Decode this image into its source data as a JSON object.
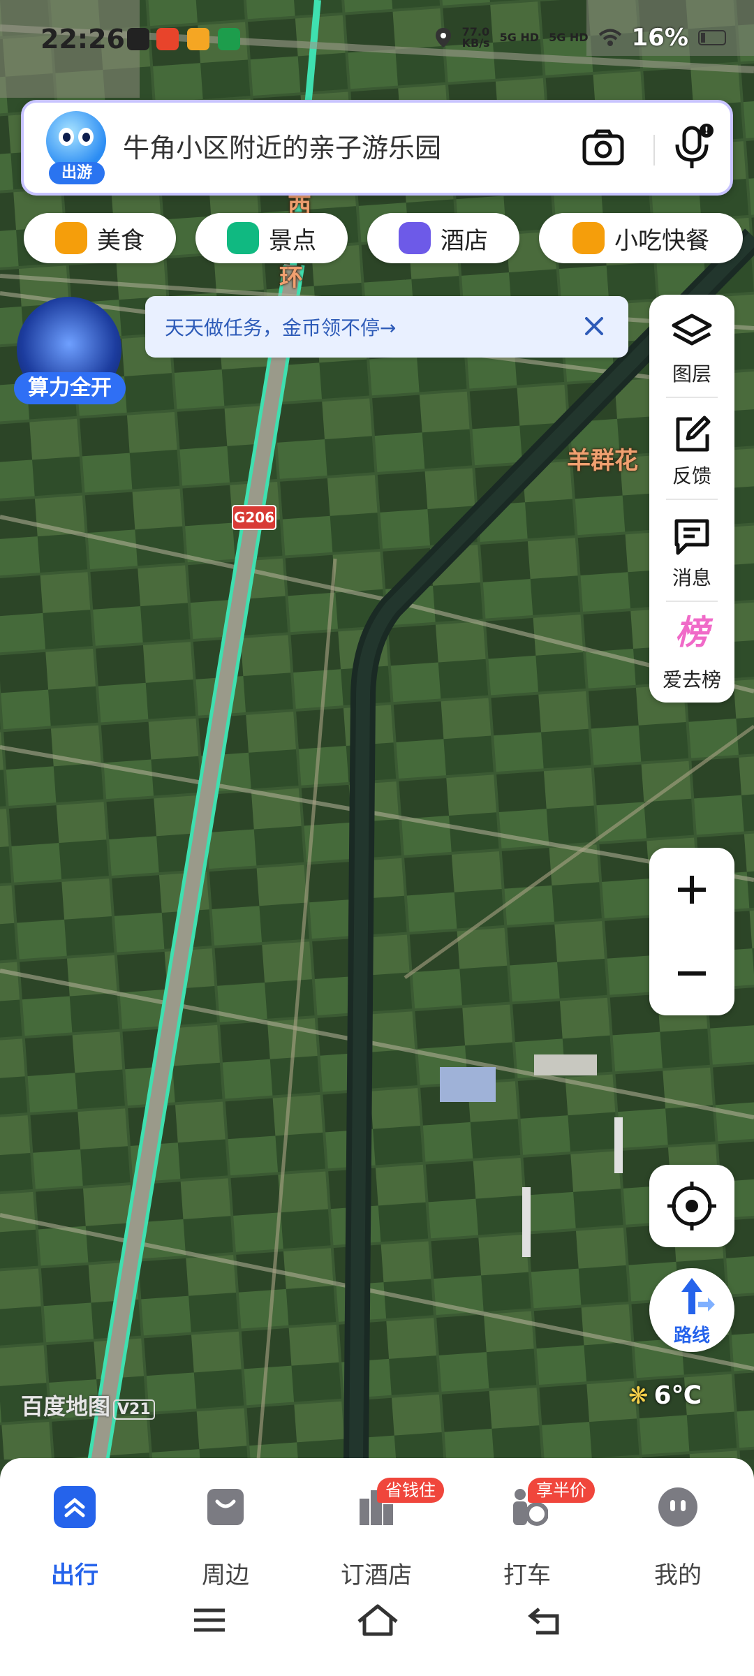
{
  "status_bar": {
    "time": "22:26",
    "net_speed_top": "77.0",
    "net_speed_unit": "KB/s",
    "sim1": "5G HD",
    "sim2": "5G HD",
    "battery": "16%"
  },
  "search": {
    "mascot_tag": "出游",
    "query": "牛角小区附近的亲子游乐园"
  },
  "chips": [
    {
      "label": "美食",
      "color": "#f59e0b"
    },
    {
      "label": "景点",
      "color": "#10b981"
    },
    {
      "label": "酒店",
      "color": "#6d5ae8"
    },
    {
      "label": "小吃快餐",
      "color": "#f59e0b"
    }
  ],
  "compute_widget": {
    "label": "算力全开"
  },
  "banner": {
    "text": "天天做任务，金币领不停→"
  },
  "toolbar": [
    {
      "label": "图层",
      "icon": "layers-icon"
    },
    {
      "label": "反馈",
      "icon": "feedback-icon"
    },
    {
      "label": "消息",
      "icon": "message-icon"
    },
    {
      "label": "爱去榜",
      "icon": "ranking-icon",
      "glyph": "榜"
    }
  ],
  "map": {
    "labels": {
      "top_road_a": "西",
      "top_road_b": "环",
      "place": "羊群花"
    },
    "road_shield": "G206",
    "brand": "百度地图",
    "brand_version": "V21",
    "temperature": "6℃"
  },
  "route_button": {
    "label": "路线"
  },
  "bottom_nav": [
    {
      "label": "出行",
      "active": true
    },
    {
      "label": "周边",
      "active": false
    },
    {
      "label": "订酒店",
      "active": false,
      "badge": "省钱住"
    },
    {
      "label": "打车",
      "active": false,
      "badge": "享半价"
    },
    {
      "label": "我的",
      "active": false
    }
  ],
  "colors": {
    "accent": "#2563eb",
    "badge": "#f0463c",
    "route_line": "#3fe0b0"
  }
}
